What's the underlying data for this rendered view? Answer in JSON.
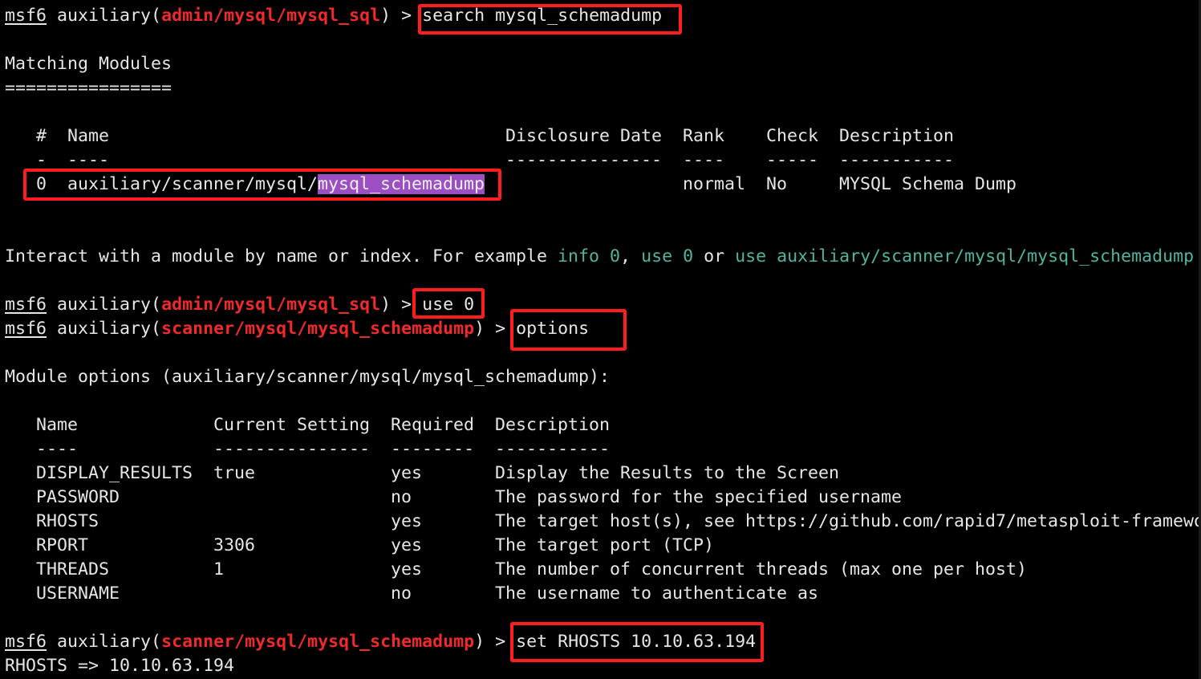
{
  "prompt": {
    "prefix": "msf6",
    "module_word": "auxiliary",
    "module_sql": "admin/mysql/mysql_sql",
    "module_schemadump": "scanner/mysql/mysql_schemadump"
  },
  "commands": {
    "search": "search mysql_schemadump",
    "use": "use 0",
    "options": "options",
    "set_rhosts": "set RHOSTS 10.10.63.194"
  },
  "search_results": {
    "heading": "Matching Modules",
    "underline": "================",
    "headers": {
      "num": "#",
      "name": "Name",
      "date": "Disclosure Date",
      "rank": "Rank",
      "check": "Check",
      "desc": "Description"
    },
    "dashes": {
      "num": "-",
      "name": "----",
      "date": "---------------",
      "rank": "----",
      "check": "-----",
      "desc": "-----------"
    },
    "row": {
      "num": "0",
      "name_prefix": "auxiliary/scanner/mysql/",
      "name_match": "mysql_schemadump",
      "rank": "normal",
      "check": "No",
      "desc": "MYSQL Schema Dump"
    }
  },
  "interact": {
    "text1": "Interact with a module by name or index. For example ",
    "link1": "info 0",
    "text2": ", ",
    "link2": "use 0",
    "text3": " or ",
    "link3": "use auxiliary/scanner/mysql/mysql_schemadump"
  },
  "module_options": {
    "heading": "Module options (auxiliary/scanner/mysql/mysql_schemadump):",
    "headers": {
      "name": "Name",
      "setting": "Current Setting",
      "required": "Required",
      "desc": "Description"
    },
    "dashes": {
      "name": "----",
      "setting": "---------------",
      "required": "--------",
      "desc": "-----------"
    },
    "rows": [
      {
        "name": "DISPLAY_RESULTS",
        "setting": "true",
        "required": "yes",
        "desc": "Display the Results to the Screen"
      },
      {
        "name": "PASSWORD",
        "setting": "",
        "required": "no",
        "desc": "The password for the specified username"
      },
      {
        "name": "RHOSTS",
        "setting": "",
        "required": "yes",
        "desc": "The target host(s), see https://github.com/rapid7/metasploit-framewo"
      },
      {
        "name": "RPORT",
        "setting": "3306",
        "required": "yes",
        "desc": "The target port (TCP)"
      },
      {
        "name": "THREADS",
        "setting": "1",
        "required": "yes",
        "desc": "The number of concurrent threads (max one per host)"
      },
      {
        "name": "USERNAME",
        "setting": "",
        "required": "no",
        "desc": "The username to authenticate as"
      }
    ]
  },
  "result": "RHOSTS => 10.10.63.194",
  "colors": {
    "prompt_module": "#f02a2a",
    "link": "#4fb59e",
    "highlight": "#9b4fc2",
    "annotation_box": "#ff1d1d",
    "background": "#000000"
  }
}
